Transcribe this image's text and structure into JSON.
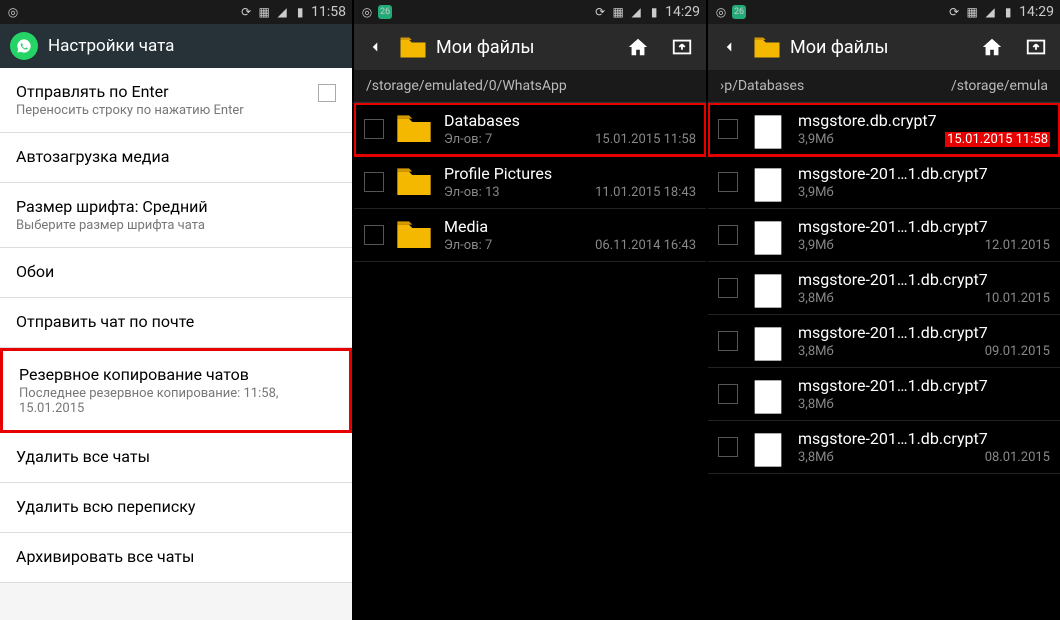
{
  "phone1": {
    "status": {
      "time": "11:58"
    },
    "header": {
      "title": "Настройки чата"
    },
    "items": [
      {
        "title": "Отправлять по Enter",
        "sub": "Переносить строку по нажатию Enter",
        "hasCheck": true
      },
      {
        "title": "Автозагрузка медиа",
        "sub": ""
      },
      {
        "title": "Размер шрифта: Средний",
        "sub": "Выберите размер шрифта чата"
      },
      {
        "title": "Обои",
        "sub": ""
      },
      {
        "title": "Отправить чат по почте",
        "sub": ""
      },
      {
        "title": "Резервное копирование чатов",
        "sub": "Последнее резервное копирование: 11:58, 15.01.2015",
        "highlighted": true
      },
      {
        "title": "Удалить все чаты",
        "sub": ""
      },
      {
        "title": "Удалить всю переписку",
        "sub": ""
      },
      {
        "title": "Архивировать все чаты",
        "sub": ""
      }
    ]
  },
  "phone2": {
    "status": {
      "time": "14:29"
    },
    "header": {
      "title": "Мои файлы"
    },
    "path": "/storage/emulated/0/WhatsApp",
    "files": [
      {
        "name": "Databases",
        "meta": "Эл-ов: 7",
        "date": "15.01.2015 11:58",
        "type": "folder",
        "highlighted": true
      },
      {
        "name": "Profile Pictures",
        "meta": "Эл-ов: 13",
        "date": "11.01.2015 18:43",
        "type": "folder"
      },
      {
        "name": "Media",
        "meta": "Эл-ов: 7",
        "date": "06.11.2014 16:43",
        "type": "folder"
      }
    ]
  },
  "phone3": {
    "status": {
      "time": "14:29"
    },
    "header": {
      "title": "Мои файлы"
    },
    "pathLeft": "›p/Databases",
    "pathRight": "/storage/emula",
    "files": [
      {
        "name": "msgstore.db.crypt7",
        "meta": "3,9Мб",
        "date": "15.01.2015 11:58",
        "type": "file",
        "highlighted": true,
        "dateHl": true
      },
      {
        "name": "msgstore-201…1.db.crypt7",
        "meta": "3,9Мб",
        "date": "",
        "type": "file"
      },
      {
        "name": "msgstore-201…1.db.crypt7",
        "meta": "3,9Мб",
        "date": "12.01.2015",
        "type": "file"
      },
      {
        "name": "msgstore-201…1.db.crypt7",
        "meta": "3,8Мб",
        "date": "10.01.2015",
        "type": "file"
      },
      {
        "name": "msgstore-201…1.db.crypt7",
        "meta": "3,8Мб",
        "date": "09.01.2015",
        "type": "file"
      },
      {
        "name": "msgstore-201…1.db.crypt7",
        "meta": "3,8Мб",
        "date": "",
        "type": "file"
      },
      {
        "name": "msgstore-201…1.db.crypt7",
        "meta": "3,8Мб",
        "date": "08.01.2015",
        "type": "file"
      }
    ]
  }
}
